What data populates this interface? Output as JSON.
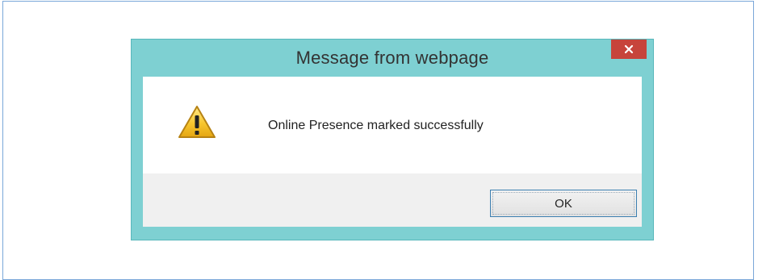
{
  "dialog": {
    "title": "Message from webpage",
    "message": "Online Presence marked successfully",
    "ok_label": "OK",
    "icons": {
      "warning": "warning-triangle-icon",
      "close": "close-icon"
    }
  },
  "colors": {
    "dialog_frame": "#7ed0d2",
    "close_button": "#c7443b",
    "content_bg": "#ffffff",
    "footer_bg": "#f0f0f0",
    "ok_border": "#3c7fb1"
  }
}
